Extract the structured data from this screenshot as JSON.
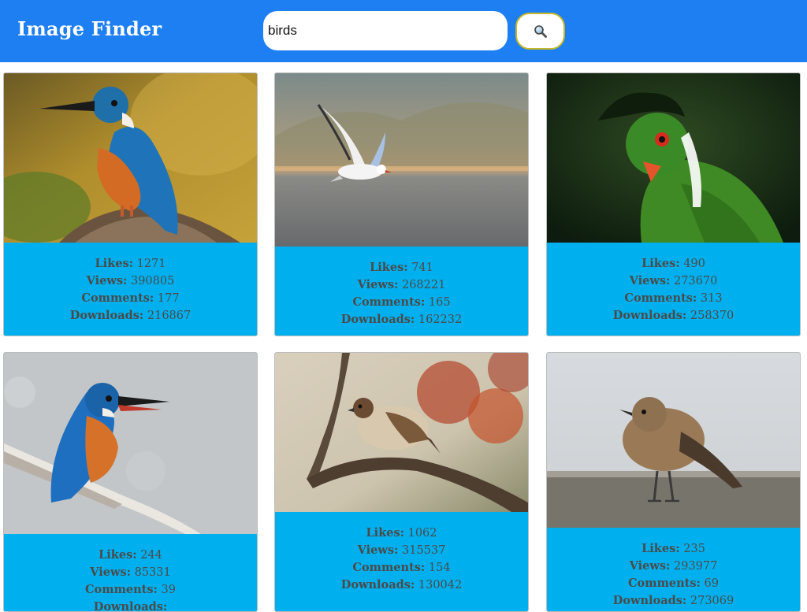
{
  "header": {
    "title": "Image Finder",
    "search": {
      "value": "birds"
    }
  },
  "labels": {
    "likes": "Likes:",
    "views": "Views:",
    "comments": "Comments:",
    "downloads": "Downloads:"
  },
  "cards": [
    {
      "subject": "kingfisher",
      "likes": "1271",
      "views": "390805",
      "comments": "177",
      "downloads": "216867"
    },
    {
      "subject": "seagull",
      "likes": "741",
      "views": "268221",
      "comments": "165",
      "downloads": "162232"
    },
    {
      "subject": "green turaco",
      "likes": "490",
      "views": "273670",
      "comments": "313",
      "downloads": "258370"
    },
    {
      "subject": "kingfisher",
      "likes": "244",
      "views": "85331",
      "comments": "39",
      "downloads": ""
    },
    {
      "subject": "sparrow",
      "likes": "1062",
      "views": "315537",
      "comments": "154",
      "downloads": "130042"
    },
    {
      "subject": "small brown bird",
      "likes": "235",
      "views": "293977",
      "comments": "69",
      "downloads": "273069"
    }
  ]
}
